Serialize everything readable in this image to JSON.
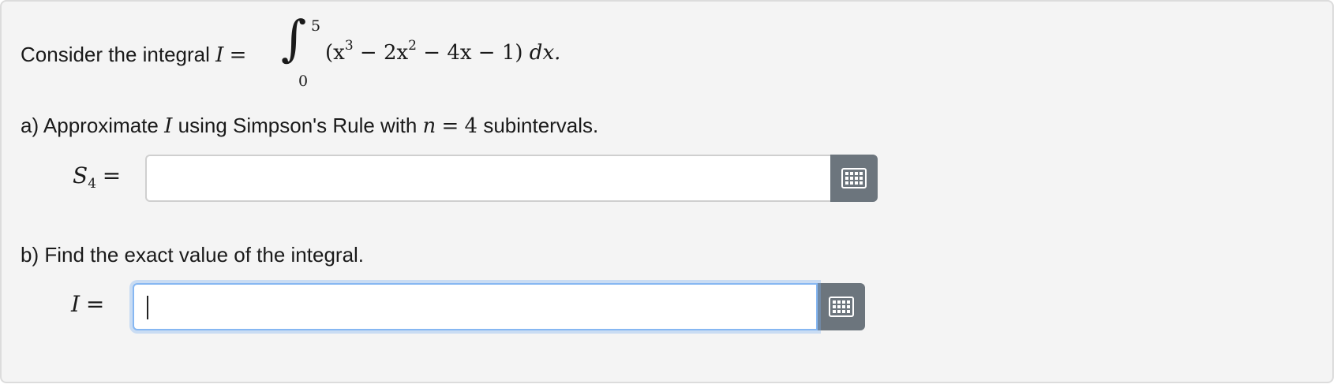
{
  "question": {
    "intro_text": "Consider the integral",
    "integral_var": "I",
    "equals": "=",
    "upper_limit": "5",
    "lower_limit": "0",
    "integrand_open": "(x",
    "exp_3": "3",
    "minus_2x": " − 2x",
    "exp_2": "2",
    "rest": " − 4x − 1)",
    "dx": " dx."
  },
  "part_a": {
    "prefix": "a) Approximate",
    "var": "I",
    "middle": "using Simpson's Rule with",
    "n_var": "n",
    "eq": "=",
    "n_value": "4",
    "suffix": "subintervals.",
    "answer_label_var": "S",
    "answer_label_sub": "4",
    "answer_label_eq": "=",
    "input_value": ""
  },
  "part_b": {
    "text": "b) Find the exact value of the integral.",
    "answer_label_var": "I",
    "answer_label_eq": "=",
    "input_value": ""
  },
  "icons": {
    "keypad": "keypad-icon"
  },
  "colors": {
    "keypad_button": "#6c757d",
    "focus_border": "#86b7f2",
    "card_background": "#f4f4f4"
  }
}
